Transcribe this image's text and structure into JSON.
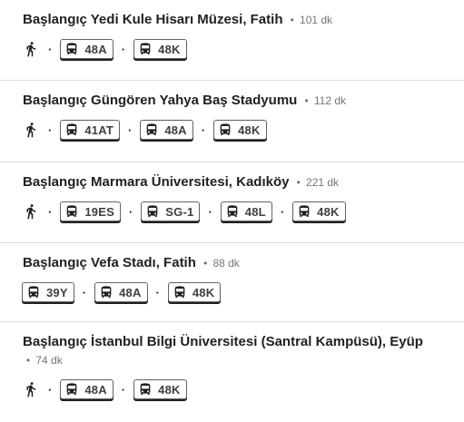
{
  "routes": [
    {
      "title": "Başlangıç Yedi Kule Hisarı Müzesi, Fatih",
      "separator": "•",
      "duration": "101 dk",
      "walk": true,
      "buses": [
        "48A",
        "48K"
      ]
    },
    {
      "title": "Başlangıç Güngören Yahya Baş Stadyumu",
      "separator": "•",
      "duration": "112 dk",
      "walk": true,
      "buses": [
        "41AT",
        "48A",
        "48K"
      ]
    },
    {
      "title": "Başlangıç Marmara Üniversitesi, Kadıköy",
      "separator": "•",
      "duration": "221 dk",
      "walk": true,
      "buses": [
        "19ES",
        "SG-1",
        "48L",
        "48K"
      ]
    },
    {
      "title": "Başlangıç Vefa Stadı, Fatih",
      "separator": "•",
      "duration": "88 dk",
      "walk": false,
      "buses": [
        "39Y",
        "48A",
        "48K"
      ]
    },
    {
      "title": "Başlangıç İstanbul Bilgi Üniversitesi (Santral Kampüsü), Eyüp",
      "separator": "•",
      "duration": "74 dk",
      "walk": true,
      "buses": [
        "48A",
        "48K"
      ]
    }
  ],
  "step_separator": "·",
  "icons": {
    "walk": "walk-icon",
    "bus": "bus-icon"
  },
  "colors": {
    "text": "#202124",
    "muted": "#70757a",
    "divider": "#dadce0"
  }
}
